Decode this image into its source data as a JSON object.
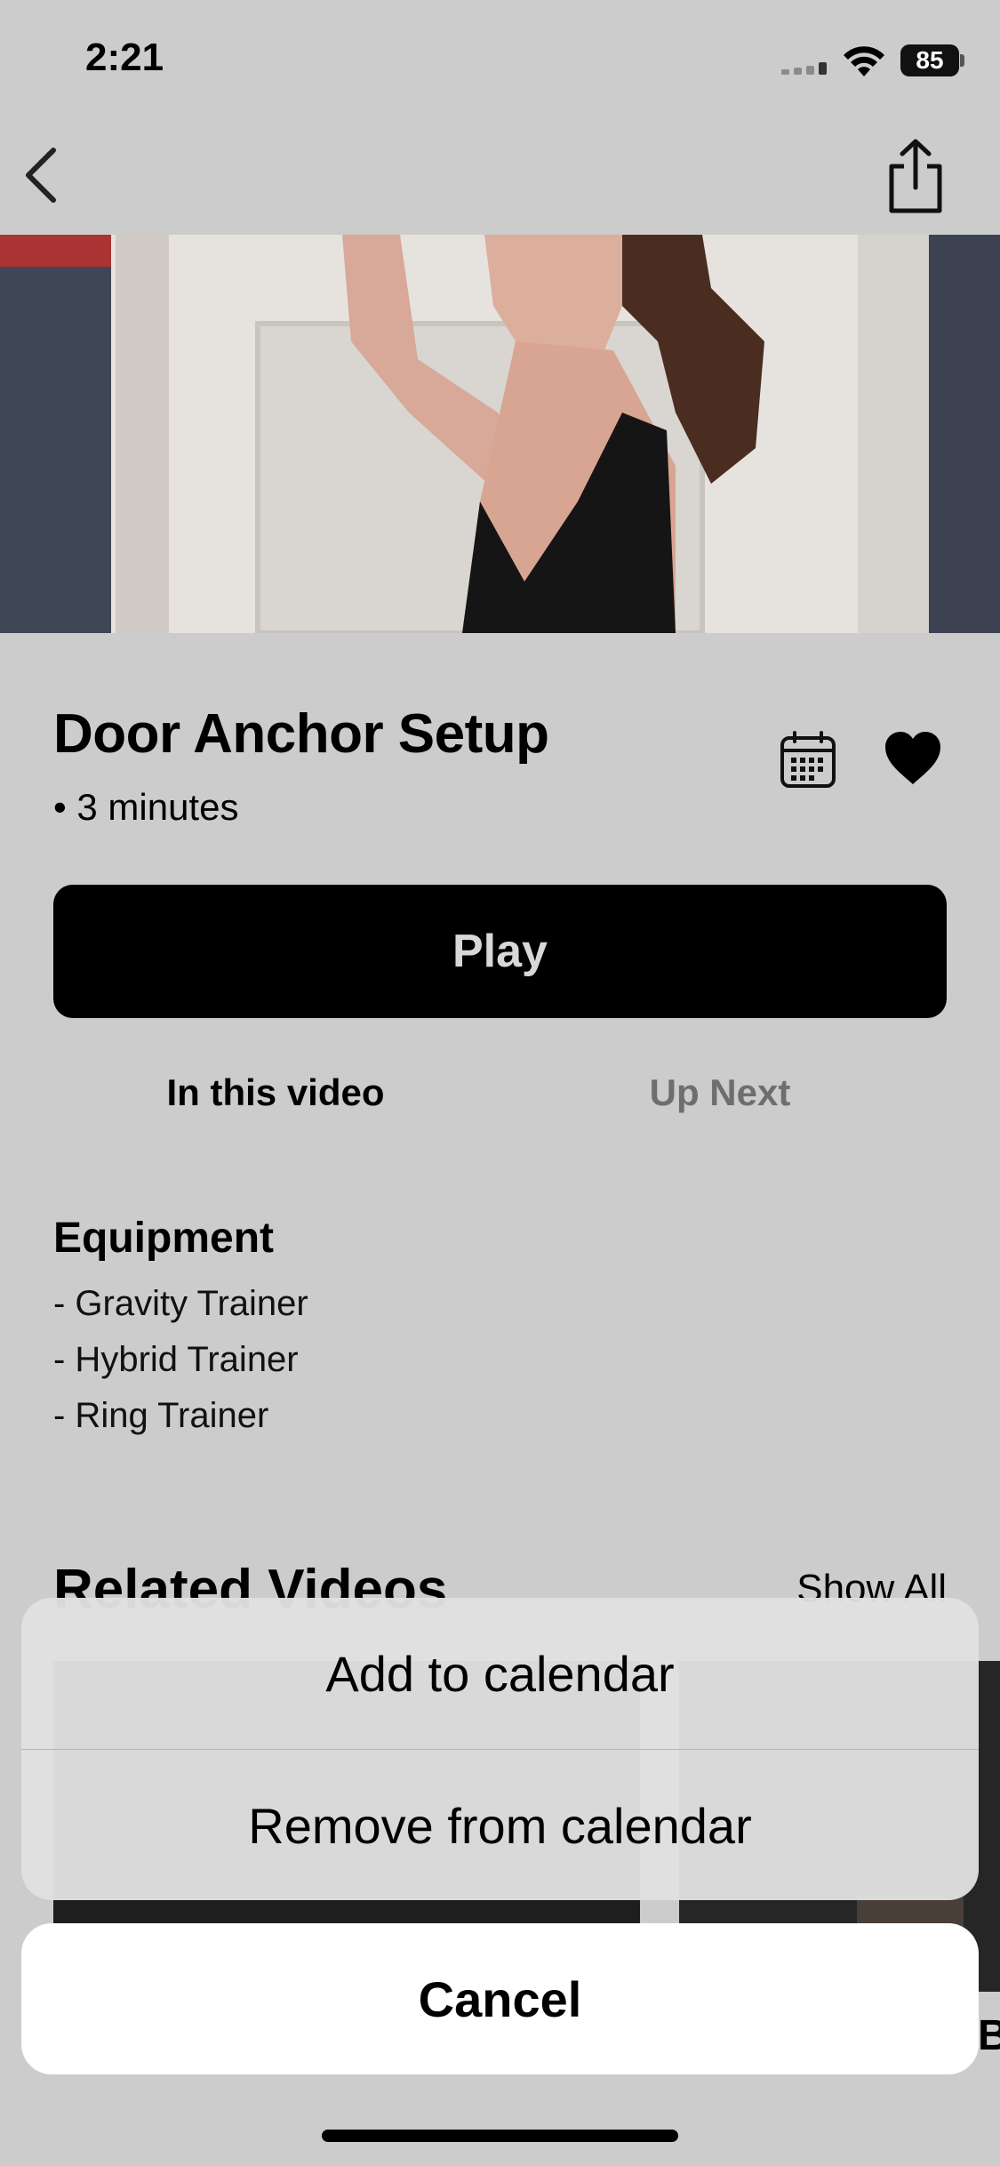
{
  "status_bar": {
    "time": "2:21",
    "battery": "85"
  },
  "nav": {
    "back_icon": "chevron-left-icon",
    "share_icon": "share-icon"
  },
  "video": {
    "title": "Door Anchor Setup",
    "duration": "• 3 minutes",
    "calendar_icon": "calendar-icon",
    "favorite_icon": "heart-icon",
    "play_label": "Play"
  },
  "tabs": [
    {
      "label": "In this video",
      "active": true
    },
    {
      "label": "Up Next",
      "active": false
    }
  ],
  "equipment": {
    "title": "Equipment",
    "items": [
      "- Gravity Trainer",
      "- Hybrid Trainer",
      "- Ring Trainer"
    ]
  },
  "related": {
    "title": "Related Videos",
    "show_all": "Show All",
    "partial_caption": "Bu"
  },
  "action_sheet": {
    "options": [
      "Add to calendar",
      "Remove from calendar"
    ],
    "cancel": "Cancel"
  },
  "colors": {
    "background": "#cccccc",
    "play_button": "#000000",
    "inactive_tab": "#6e6e6e"
  }
}
